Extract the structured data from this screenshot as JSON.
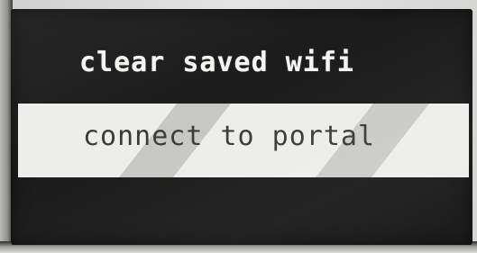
{
  "menu": {
    "items": [
      {
        "label": "clear saved wifi"
      },
      {
        "label": "connect to portal"
      }
    ],
    "selected_index": 1
  },
  "colors": {
    "screen_bg": "#1b1c1b",
    "text_inactive": "#f4f4f2",
    "highlight_bg": "#ededeb",
    "text_active": "#3b3b3a"
  }
}
